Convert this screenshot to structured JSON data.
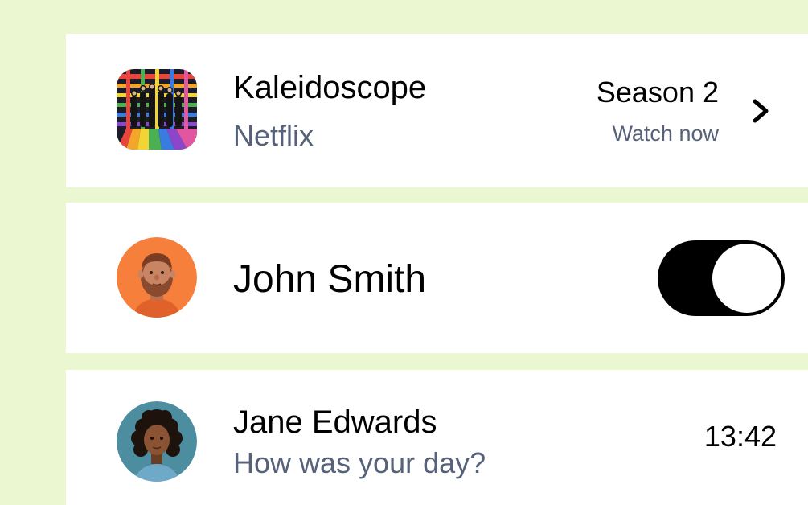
{
  "items": [
    {
      "title": "Kaleidoscope",
      "subtitle": "Netflix",
      "meta_title": "Season 2",
      "meta_subtitle": "Watch now",
      "thumbnail": "show-poster",
      "trailing_icon": "chevron-right-icon"
    },
    {
      "title": "John Smith",
      "thumbnail": "avatar-bearded-man",
      "toggle": {
        "state": "on"
      }
    },
    {
      "title": "Jane Edwards",
      "subtitle": "How was your day?",
      "time": "13:42",
      "thumbnail": "avatar-curly-hair-woman"
    }
  ],
  "colors": {
    "background": "#ebf7d1",
    "card": "#ffffff",
    "text_primary": "#000000",
    "text_secondary": "#566279",
    "avatar_orange": "#f67f3c",
    "avatar_teal": "#4d8da0"
  }
}
